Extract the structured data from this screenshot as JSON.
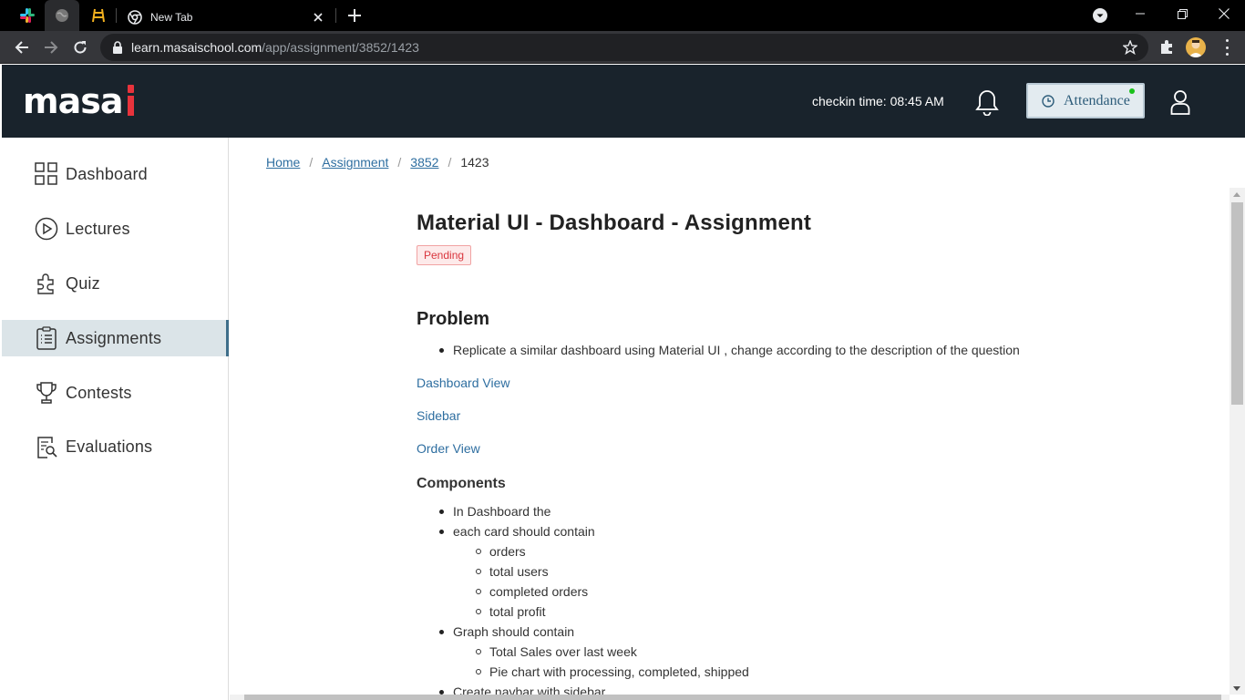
{
  "browser": {
    "tabs": [
      {
        "title": "New Tab"
      }
    ],
    "url_host": "learn.masaischool.com",
    "url_path": "/app/assignment/3852/1423"
  },
  "header": {
    "logo_text": "masa",
    "checkin": "checkin time: 08:45 AM",
    "attendance_label": "Attendance",
    "colors": {
      "header_bg": "#19232c",
      "logo_accent": "#e8333c",
      "online_dot": "#19c11a"
    }
  },
  "sidebar": {
    "items": [
      {
        "label": "Dashboard",
        "icon": "grid-icon"
      },
      {
        "label": "Lectures",
        "icon": "play-circle-icon"
      },
      {
        "label": "Quiz",
        "icon": "puzzle-icon"
      },
      {
        "label": "Assignments",
        "icon": "clipboard-list-icon",
        "active": true
      },
      {
        "label": "Contests",
        "icon": "trophy-icon"
      },
      {
        "label": "Evaluations",
        "icon": "report-search-icon"
      }
    ]
  },
  "breadcrumb": {
    "items": [
      "Home",
      "Assignment",
      "3852"
    ],
    "current": "1423"
  },
  "assignment": {
    "title": "Material UI - Dashboard - Assignment",
    "status": "Pending",
    "problem_heading": "Problem",
    "problem_bullet": "Replicate a similar dashboard using Material UI , change according to the description of the question",
    "links": [
      "Dashboard View",
      "Sidebar",
      "Order View"
    ],
    "components_heading": "Components",
    "components": {
      "b1": "In Dashboard the",
      "b2": "each card should contain",
      "b2_sub": [
        "orders",
        "total users",
        "completed orders",
        "total profit"
      ],
      "b3": "Graph should contain",
      "b3_sub": [
        "Total Sales over last week",
        "Pie chart with processing, completed, shipped"
      ],
      "b4": "Create navbar with sidebar"
    }
  }
}
